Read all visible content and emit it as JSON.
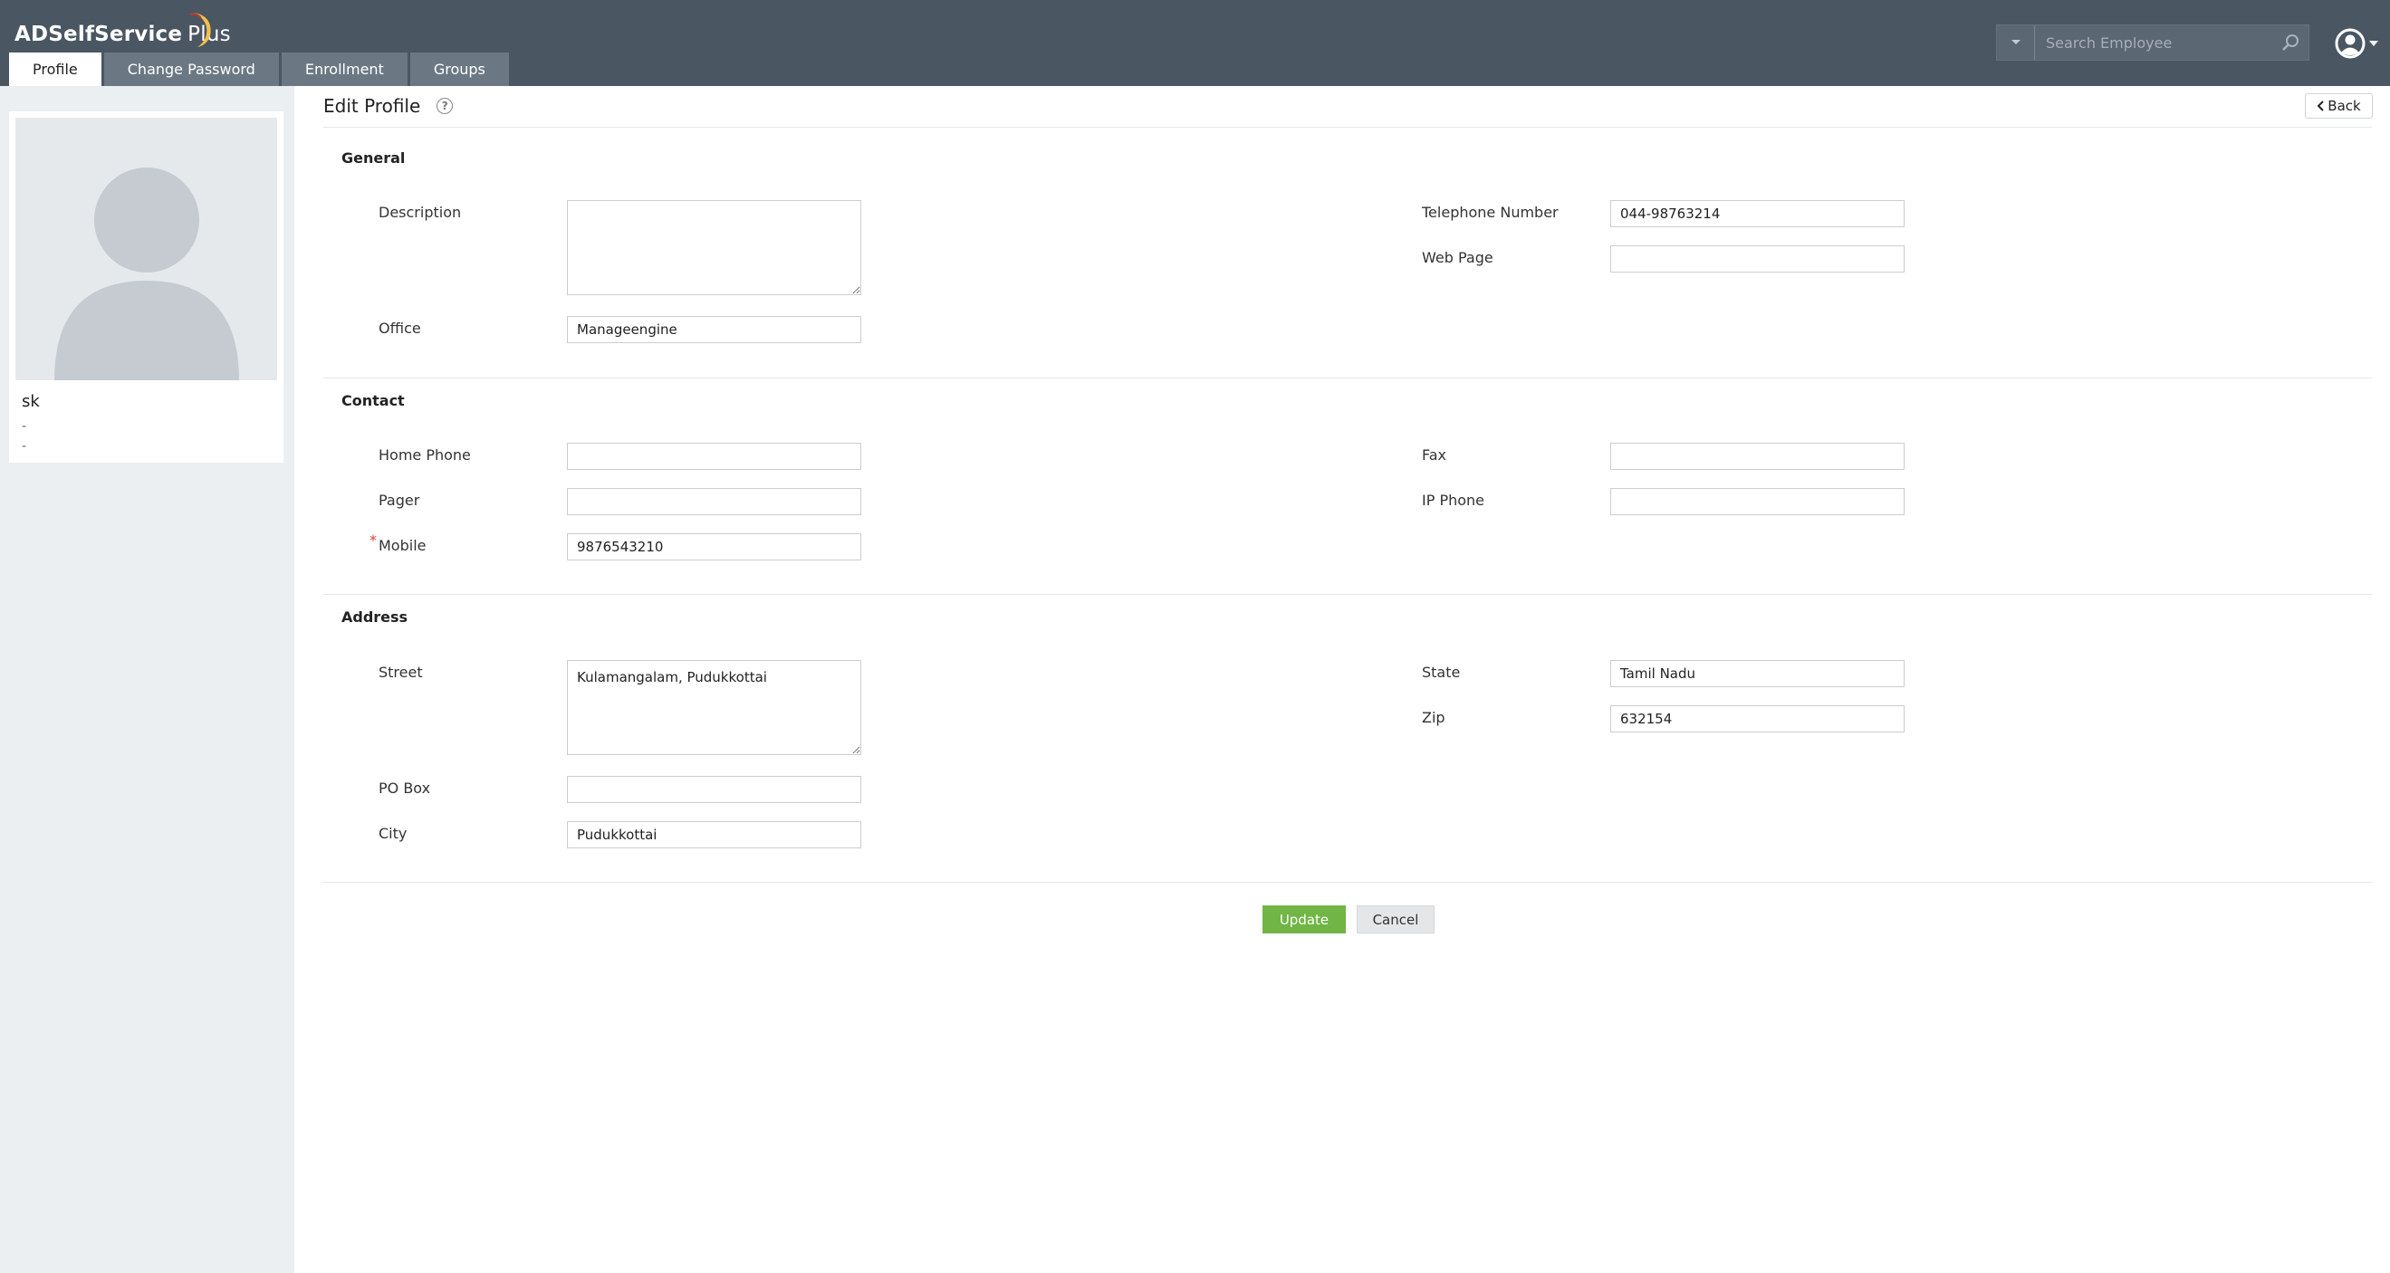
{
  "app": {
    "brand_main": "ADSelfService",
    "brand_plus": "Plus",
    "brand_accent": "#e8a23a"
  },
  "tabs": [
    {
      "label": "Profile",
      "active": true
    },
    {
      "label": "Change Password",
      "active": false
    },
    {
      "label": "Enrollment",
      "active": false
    },
    {
      "label": "Groups",
      "active": false
    }
  ],
  "search": {
    "placeholder": "Search Employee",
    "icons": [
      "caret-down-icon",
      "search-icon"
    ]
  },
  "user_menu": {
    "icon": "user-circle-icon"
  },
  "profile_card": {
    "name": "sk",
    "line1": "-",
    "line2": "-"
  },
  "page": {
    "title": "Edit Profile",
    "back_label": "Back"
  },
  "sections": {
    "general": {
      "title": "General",
      "description_label": "Description",
      "description_value": "",
      "office_label": "Office",
      "office_value": "Manageengine",
      "telephone_label": "Telephone Number",
      "telephone_value": "044-98763214",
      "webpage_label": "Web Page",
      "webpage_value": ""
    },
    "contact": {
      "title": "Contact",
      "home_phone_label": "Home Phone",
      "home_phone_value": "",
      "pager_label": "Pager",
      "pager_value": "",
      "mobile_label": "Mobile",
      "mobile_value": "9876543210",
      "required_mark": "*",
      "fax_label": "Fax",
      "fax_value": "",
      "ip_phone_label": "IP Phone",
      "ip_phone_value": ""
    },
    "address": {
      "title": "Address",
      "street_label": "Street",
      "street_value": "Kulamangalam, Pudukkottai",
      "po_box_label": "PO Box",
      "po_box_value": "",
      "city_label": "City",
      "city_value": "Pudukkottai",
      "state_label": "State",
      "state_value": "Tamil Nadu",
      "zip_label": "Zip",
      "zip_value": "632154"
    }
  },
  "actions": {
    "update_label": "Update",
    "cancel_label": "Cancel"
  },
  "colors": {
    "header_bg": "#4a5662",
    "update_green": "#70b545"
  }
}
